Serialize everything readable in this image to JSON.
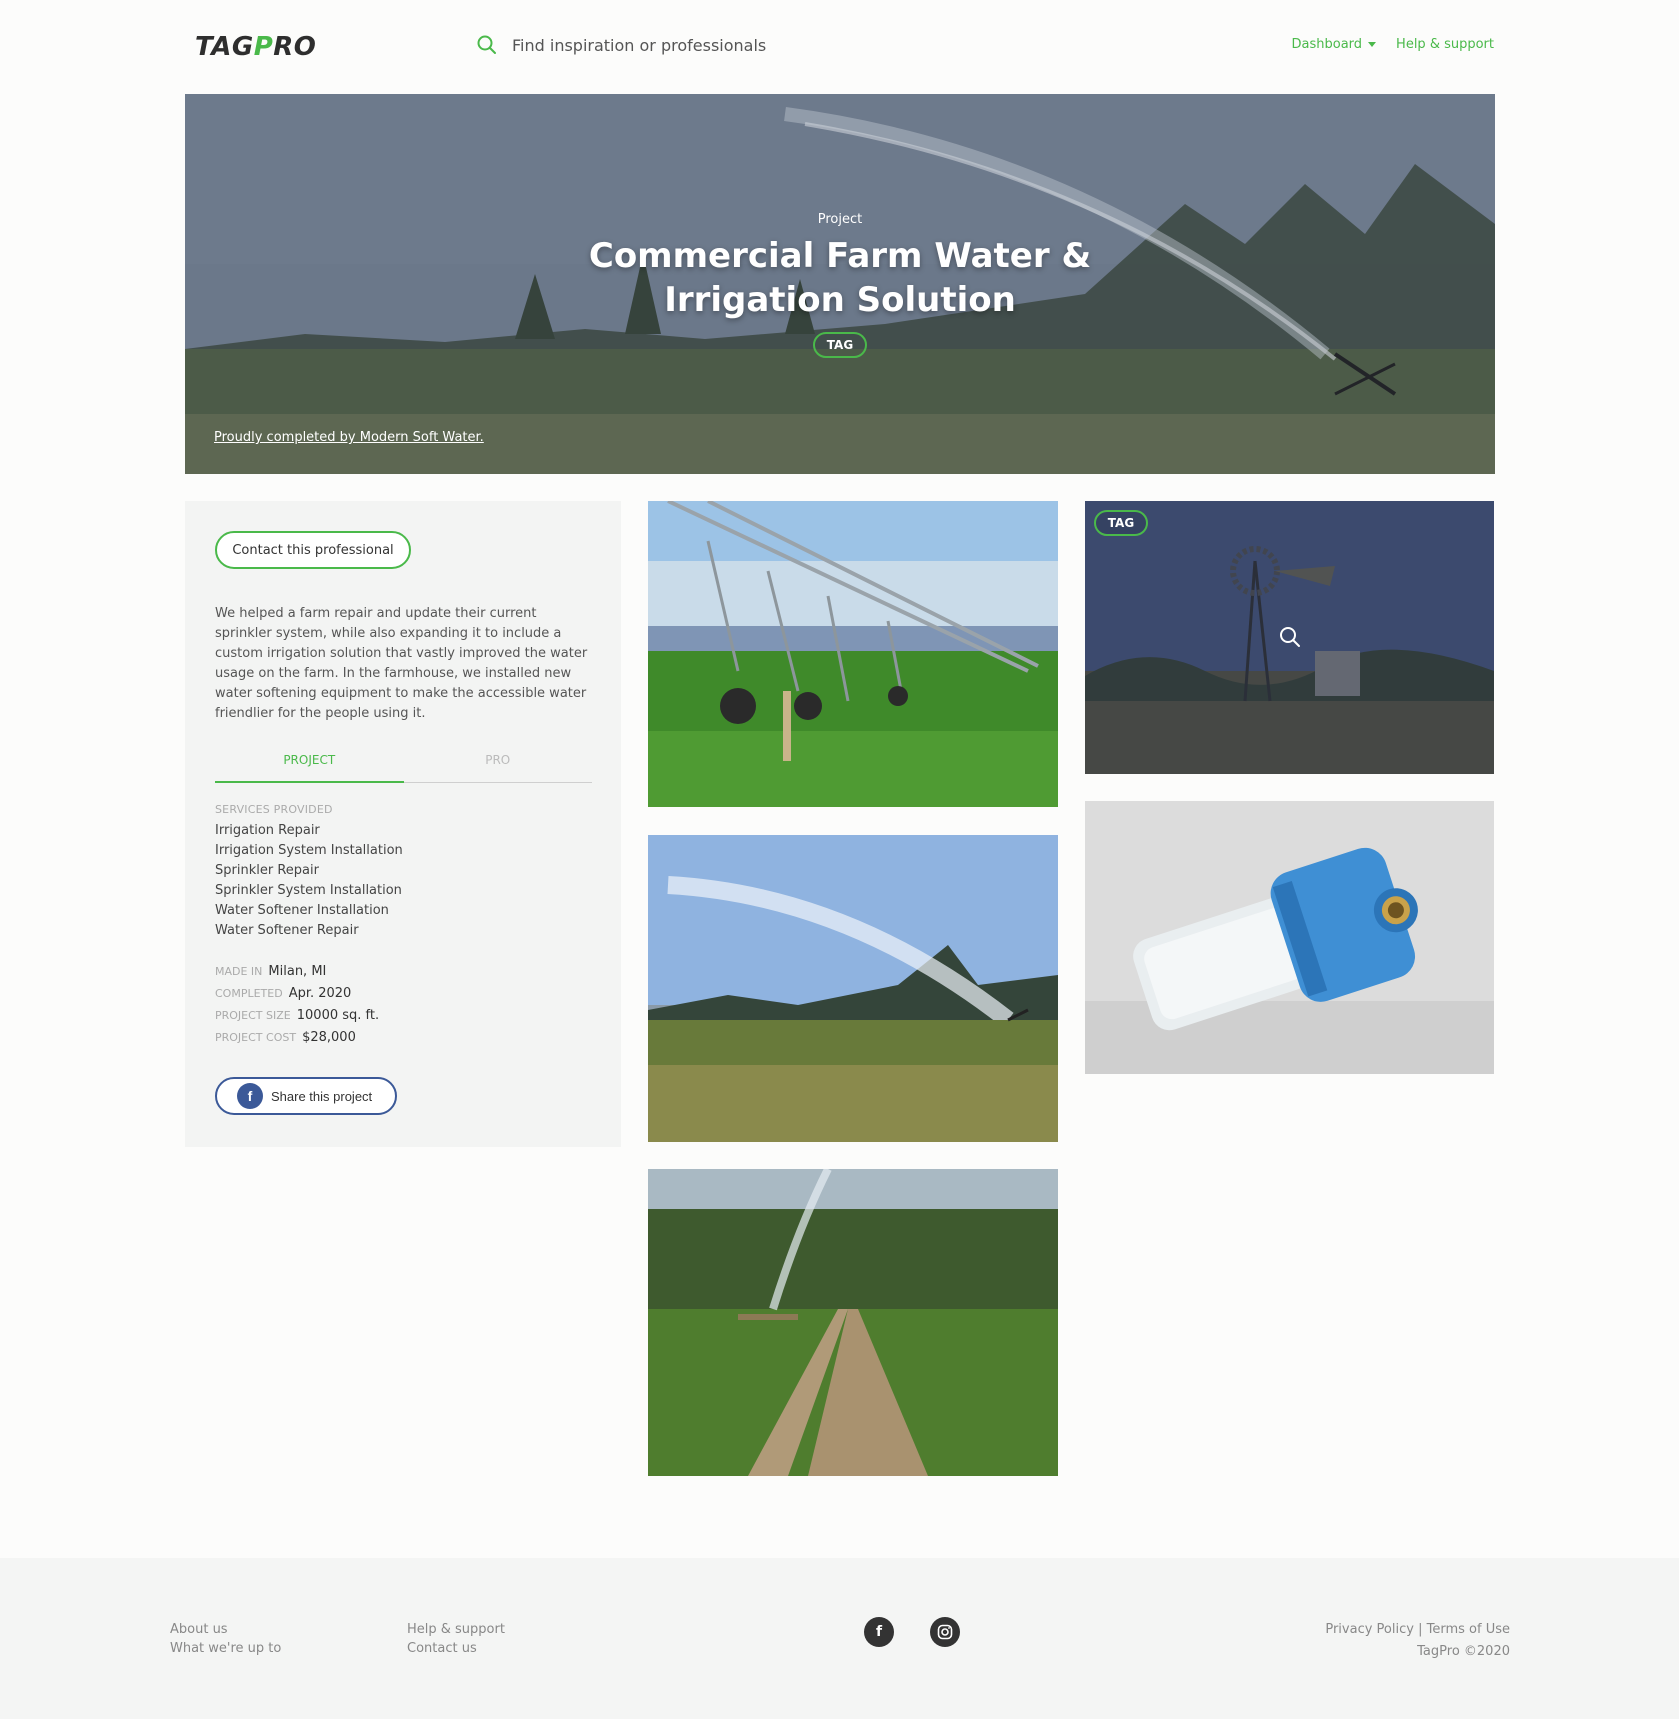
{
  "header": {
    "logo_pre": "TAG",
    "logo_p": "P",
    "logo_post": "RO",
    "search_placeholder": "Find inspiration or professionals",
    "nav": {
      "dashboard": "Dashboard",
      "help": "Help & support"
    }
  },
  "hero": {
    "kicker": "Project",
    "title": "Commercial Farm Water & Irrigation Solution",
    "tag": "TAG",
    "credit": "Proudly completed by Modern Soft Water."
  },
  "sidebar": {
    "contact_label": "Contact this professional",
    "description": "We helped a farm repair and update their current sprinkler system, while also expanding it to include a custom irrigation solution that vastly improved the water usage on the farm. In the farmhouse, we installed new water softening equipment to make the accessible water friendlier for the people using it.",
    "tabs": [
      "PROJECT",
      "PRO"
    ],
    "services_label": "SERVICES PROVIDED",
    "services": [
      "Irrigation Repair",
      "Irrigation System Installation",
      "Sprinkler Repair",
      "Sprinkler System Installation",
      "Water Softener Installation",
      "Water Softener Repair"
    ],
    "meta": {
      "made_in_label": "MADE IN",
      "made_in": "Milan, MI",
      "completed_label": "COMPLETED",
      "completed": "Apr. 2020",
      "size_label": "PROJECT SIZE",
      "size": "10000 sq. ft.",
      "cost_label": "PROJECT COST",
      "cost": "$28,000"
    },
    "share_label": "Share this project"
  },
  "gallery": {
    "tag": "TAG"
  },
  "footer": {
    "col1": [
      "About us",
      "What we're up to"
    ],
    "col2": [
      "Help & support",
      "Contact us"
    ],
    "privacy": "Privacy Policy",
    "separator": "|",
    "terms": "Terms of Use",
    "copyright": "TagPro ©2020"
  },
  "colors": {
    "accent": "#4ab94a",
    "facebook": "#3b5998"
  },
  "icons": [
    "search-icon",
    "caret-down-icon",
    "zoom-icon",
    "facebook-icon",
    "instagram-icon"
  ]
}
